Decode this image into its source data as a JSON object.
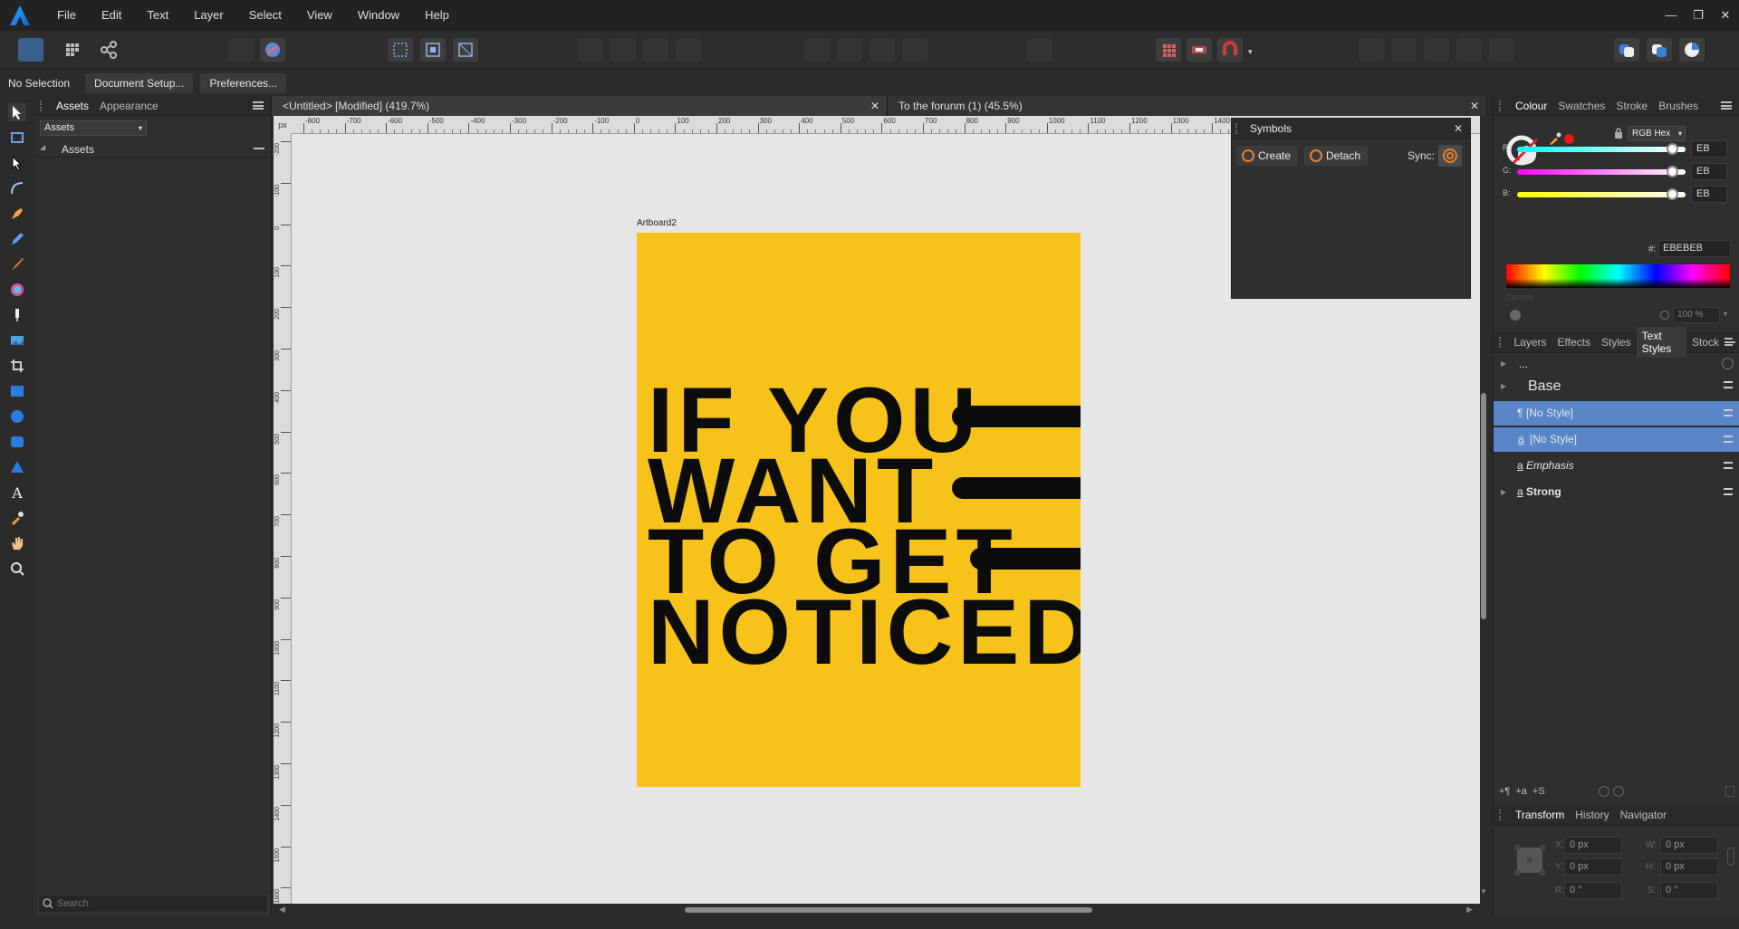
{
  "app": {
    "menu": [
      "File",
      "Edit",
      "Text",
      "Layer",
      "Select",
      "View",
      "Window",
      "Help"
    ]
  },
  "context": {
    "selection": "No Selection",
    "document_setup": "Document Setup...",
    "preferences": "Preferences..."
  },
  "assets_panel": {
    "tabs": [
      "Assets",
      "Appearance"
    ],
    "dropdown": "Assets",
    "section": "Assets",
    "search_placeholder": "Search"
  },
  "documents": {
    "tabs": [
      "<Untitled> [Modified] (419.7%)",
      "To the forunm (1) (45.5%)"
    ]
  },
  "ruler": {
    "unit": "px",
    "h_ticks": [
      "-800",
      "-700",
      "-600",
      "-500",
      "-400",
      "-300",
      "-200",
      "-100",
      "0",
      "100",
      "200",
      "300",
      "400",
      "500",
      "600",
      "700",
      "800",
      "900",
      "1000",
      "1100",
      "1200",
      "1300",
      "1400"
    ],
    "v_ticks": [
      "-200",
      "-100",
      "0",
      "100",
      "200",
      "300",
      "400",
      "500",
      "600",
      "700",
      "800",
      "900",
      "1000",
      "1100",
      "1200",
      "1300",
      "1400",
      "1500",
      "1600"
    ]
  },
  "artboard": {
    "label": "Artboard2",
    "lines": [
      "IF YOU",
      "WANT",
      "TO GET",
      "NOTICED"
    ],
    "bg": "#F7C31A",
    "ink": "#0C0C0C"
  },
  "symbols": {
    "title": "Symbols",
    "create": "Create",
    "detach": "Detach",
    "sync": "Sync:"
  },
  "colour": {
    "tabs": [
      "Colour",
      "Swatches",
      "Stroke",
      "Brushes"
    ],
    "model": "RGB Hex",
    "r_label": "R:",
    "g_label": "G:",
    "b_label": "B:",
    "r": "EB",
    "g": "EB",
    "b": "EB",
    "hex_label": "#:",
    "hex": "EBEBEB",
    "opacity_label": "Opacity",
    "opacity": "100 %"
  },
  "styles_panel": {
    "tabs": [
      "Layers",
      "Effects",
      "Styles",
      "Text Styles",
      "Stock"
    ],
    "filter": "...",
    "items": [
      {
        "label": "Base"
      },
      {
        "label": "[No Style]",
        "prefix": "¶"
      },
      {
        "label": "[No Style]",
        "prefix": "a"
      },
      {
        "label": "Emphasis",
        "prefix": "a"
      },
      {
        "label": "Strong",
        "prefix": "a"
      }
    ],
    "bottom_icons": [
      "+¶",
      "+a",
      "+S"
    ]
  },
  "transform": {
    "tabs": [
      "Transform",
      "History",
      "Navigator"
    ],
    "x_label": "X:",
    "y_label": "Y:",
    "w_label": "W:",
    "h_label": "H:",
    "r_label": "R:",
    "s_label": "S:",
    "x": "0 px",
    "y": "0 px",
    "w": "0 px",
    "h": "0 px",
    "r": "0 °",
    "s": "0 °"
  }
}
